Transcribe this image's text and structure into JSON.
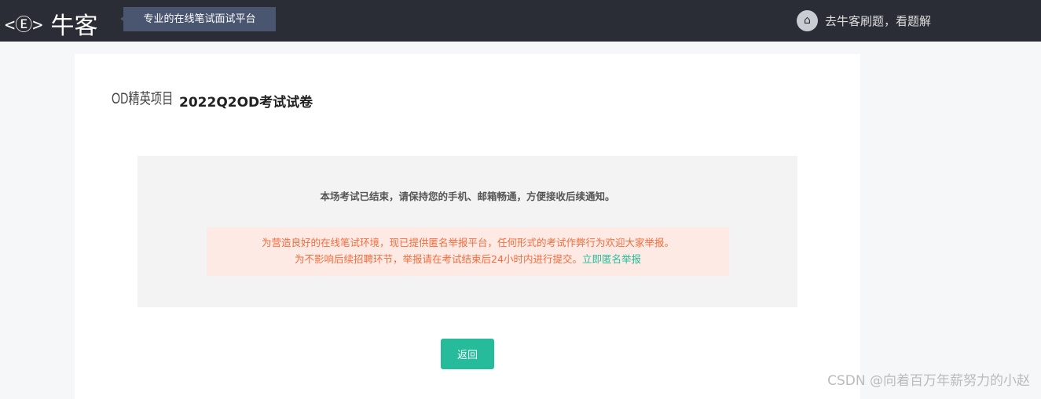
{
  "header": {
    "logo_text": "牛客",
    "slogan": "专业的在线笔试面试平台",
    "home_link": "去牛客刷题，看题解"
  },
  "main": {
    "project_label": "OD精英项目",
    "exam_title": "2022Q2OD考试试卷",
    "ended_message": "本场考试已结束，请保持您的手机、邮箱畅通，方便接收后续通知。",
    "notice_line1": "为营造良好的在线笔试环境，现已提供匿名举报平台，任何形式的考试作弊行为欢迎大家举报。",
    "notice_line2": "为不影响后续招聘环节，举报请在考试结束后24小时内进行提交。",
    "report_link": "立即匿名举报",
    "back_button": "返回"
  },
  "watermark": "CSDN @向着百万年薪努力的小赵"
}
